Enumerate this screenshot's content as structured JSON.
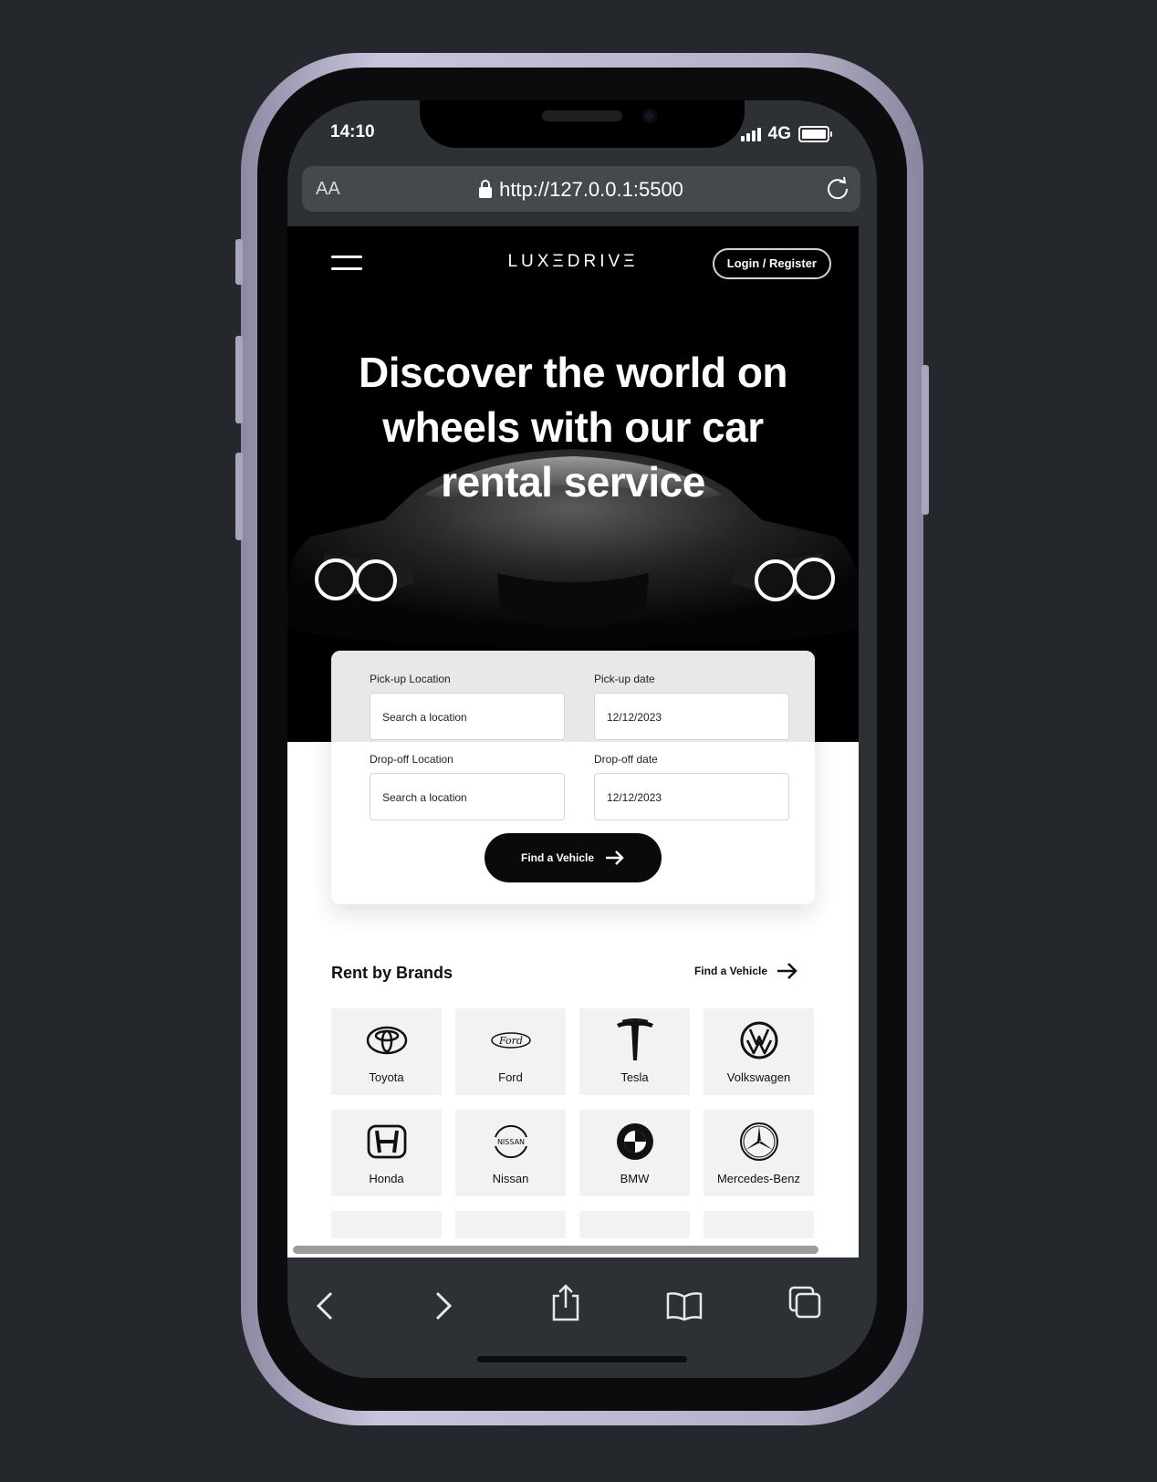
{
  "status_bar": {
    "time": "14:10",
    "network": "4G"
  },
  "browser": {
    "text_size_label": "AA",
    "url": "http://127.0.0.1:5500"
  },
  "site": {
    "logo": "LUXΞDRIVΞ",
    "login_label": "Login / Register",
    "hero_title": "Discover the world on wheels with our car rental service"
  },
  "search": {
    "pickup_location_label": "Pick-up Location",
    "pickup_location_placeholder": "Search a location",
    "pickup_date_label": "Pick-up date",
    "pickup_date_value": "12/12/2023",
    "dropoff_location_label": "Drop-off Location",
    "dropoff_location_placeholder": "Search a location",
    "dropoff_date_label": "Drop-off date",
    "dropoff_date_value": "12/12/2023",
    "submit_label": "Find a Vehicle"
  },
  "brands_section": {
    "title": "Rent by Brands",
    "link_label": "Find a Vehicle",
    "brands": [
      {
        "name": "Toyota",
        "icon": "toyota-logo-icon"
      },
      {
        "name": "Ford",
        "icon": "ford-logo-icon"
      },
      {
        "name": "Tesla",
        "icon": "tesla-logo-icon"
      },
      {
        "name": "Volkswagen",
        "icon": "volkswagen-logo-icon"
      },
      {
        "name": "Honda",
        "icon": "honda-logo-icon"
      },
      {
        "name": "Nissan",
        "icon": "nissan-logo-icon"
      },
      {
        "name": "BMW",
        "icon": "bmw-logo-icon"
      },
      {
        "name": "Mercedes-Benz",
        "icon": "mercedes-logo-icon"
      }
    ]
  },
  "colors": {
    "page_bg": "#24272c",
    "hero_bg": "#000000",
    "accent": "#0a0a0a",
    "tile_bg": "#f2f2f2"
  }
}
